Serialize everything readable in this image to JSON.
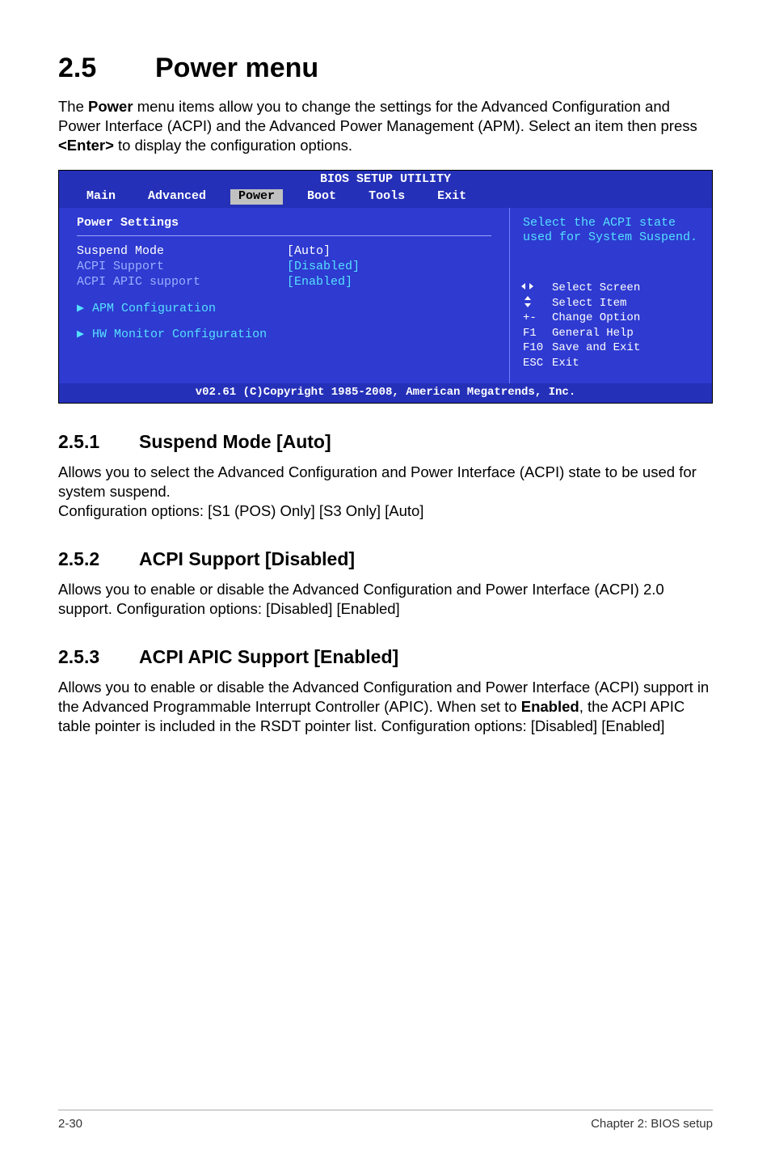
{
  "section": {
    "number": "2.5",
    "title": "Power menu"
  },
  "intro": "The Power menu items allow you to change the settings for the Advanced Configuration and Power Interface (ACPI) and the Advanced Power Management (APM). Select an item then press <Enter> to display the configuration options.",
  "bios": {
    "header": "BIOS SETUP UTILITY",
    "tabs": [
      "Main",
      "Advanced",
      "Power",
      "Boot",
      "Tools",
      "Exit"
    ],
    "active_tab_index": 2,
    "panel_title": "Power Settings",
    "rows": [
      {
        "label": "Suspend Mode",
        "value": "[Auto]",
        "selected": true
      },
      {
        "label": "ACPI Support",
        "value": "[Disabled]"
      },
      {
        "label": "ACPI APIC support",
        "value": "[Enabled]"
      }
    ],
    "submenus": [
      "APM Configuration",
      "HW Monitor Configuration"
    ],
    "help": "Select the ACPI state used for System Suspend.",
    "legend": [
      {
        "key_icon": "leftright",
        "text": "Select Screen"
      },
      {
        "key_icon": "updown",
        "text": "Select Item"
      },
      {
        "key": "+-",
        "text": "Change Option"
      },
      {
        "key": "F1",
        "text": "General Help"
      },
      {
        "key": "F10",
        "text": "Save and Exit"
      },
      {
        "key": "ESC",
        "text": "Exit"
      }
    ],
    "footer": "v02.61 (C)Copyright 1985-2008, American Megatrends, Inc."
  },
  "subsections": [
    {
      "number": "2.5.1",
      "title": "Suspend Mode [Auto]",
      "body": "Allows you to select the Advanced Configuration and Power Interface (ACPI) state to be used for system suspend.\nConfiguration options: [S1 (POS) Only] [S3 Only] [Auto]"
    },
    {
      "number": "2.5.2",
      "title": "ACPI Support [Disabled]",
      "body": "Allows you to enable or disable the Advanced Configuration and Power Interface (ACPI) 2.0 support. Configuration options: [Disabled] [Enabled]"
    },
    {
      "number": "2.5.3",
      "title": "ACPI APIC Support [Enabled]",
      "body": "Allows you to enable or disable the Advanced Configuration and Power Interface (ACPI) support in the Advanced Programmable Interrupt Controller (APIC). When set to Enabled, the ACPI APIC table pointer is included in the RSDT pointer list. Configuration options: [Disabled] [Enabled]"
    }
  ],
  "footer": {
    "left": "2-30",
    "right": "Chapter 2: BIOS setup"
  }
}
